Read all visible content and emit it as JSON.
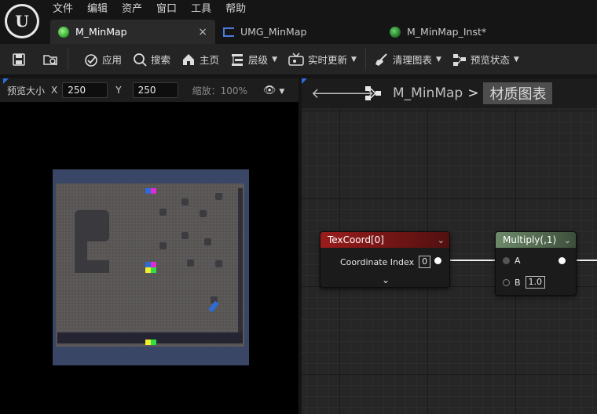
{
  "menu": [
    "文件",
    "编辑",
    "资产",
    "窗口",
    "工具",
    "帮助"
  ],
  "tabs": [
    {
      "label": "M_MinMap",
      "icon": "material-icon",
      "active": true
    },
    {
      "label": "UMG_MinMap",
      "icon": "widget-blueprint-icon",
      "active": false
    },
    {
      "label": "M_MinMap_Inst*",
      "icon": "material-instance-icon",
      "active": false
    }
  ],
  "tab_close": "×",
  "toolbar": {
    "apply": "应用",
    "search": "搜索",
    "home": "主页",
    "hierarchy": "层级",
    "live_update": "实时更新",
    "clean_graph": "清理图表",
    "preview_state": "预览状态"
  },
  "preview": {
    "size_label": "预览大小",
    "x_label": "X",
    "x_value": "250",
    "y_label": "Y",
    "y_value": "250",
    "zoom": "缩放：100%"
  },
  "graph": {
    "breadcrumb_root": "M_MinMap",
    "breadcrumb_sep": ">",
    "breadcrumb_current": "材质图表"
  },
  "nodes": {
    "texcoord": {
      "title": "TexCoord[0]",
      "pin_label": "Coordinate Index",
      "pin_value": "0"
    },
    "multiply": {
      "title": "Multiply(,1)",
      "pin_a": "A",
      "pin_b": "B",
      "pin_b_value": "1.0"
    }
  },
  "colors": {
    "accent_blue": "#2d6fe0",
    "texcoord_header": "#9a1c1c",
    "multiply_header": "#6d8a6a"
  }
}
